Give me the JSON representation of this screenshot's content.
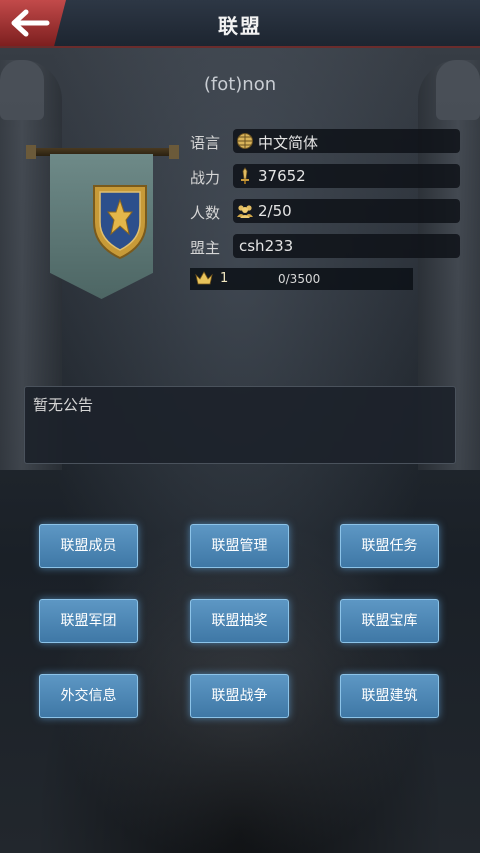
{
  "header": {
    "title": "联盟"
  },
  "alliance": {
    "name": "(fot)non",
    "info": [
      {
        "label": "语言",
        "value": "中文简体",
        "icon": "globe-icon"
      },
      {
        "label": "战力",
        "value": "37652",
        "icon": "sword-icon"
      },
      {
        "label": "人数",
        "value": "2/50",
        "icon": "people-icon"
      },
      {
        "label": "盟主",
        "value": "csh233"
      }
    ],
    "level": {
      "icon": "crown-icon",
      "value": "1",
      "exp": "0/3500"
    }
  },
  "announcement": {
    "text": "暂无公告"
  },
  "buttons": [
    {
      "label": "联盟成员"
    },
    {
      "label": "联盟管理"
    },
    {
      "label": "联盟任务"
    },
    {
      "label": "联盟军团"
    },
    {
      "label": "联盟抽奖"
    },
    {
      "label": "联盟宝库"
    },
    {
      "label": "外交信息"
    },
    {
      "label": "联盟战争"
    },
    {
      "label": "联盟建筑"
    }
  ],
  "colors": {
    "accent_button": "#4a86b5",
    "header_back": "#a83434",
    "banner": "#5d7674"
  }
}
